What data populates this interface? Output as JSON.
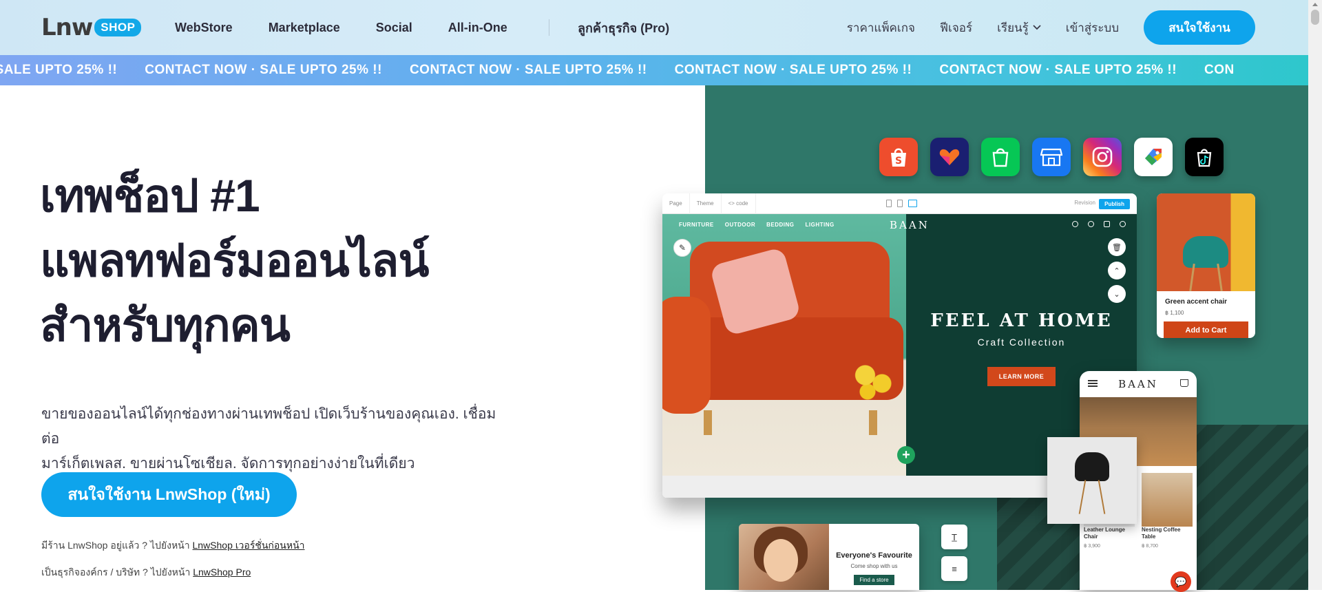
{
  "header": {
    "logo": {
      "lnw": "Lnw",
      "shop": "SHOP"
    },
    "nav_left": [
      "WebStore",
      "Marketplace",
      "Social",
      "All-in-One"
    ],
    "nav_pro": "ลูกค้าธุรกิจ (Pro)",
    "nav_right": {
      "pricing": "ราคาแพ็คเกจ",
      "features": "ฟีเจอร์",
      "learn": "เรียนรู้",
      "login": "เข้าสู่ระบบ"
    },
    "cta": "สนใจใช้งาน"
  },
  "marquee": {
    "segments": [
      "· SALE UPTO 25% !!",
      "CONTACT NOW · SALE UPTO 25% !!",
      "CONTACT NOW · SALE UPTO 25% !!",
      "CONTACT NOW · SALE UPTO 25% !!",
      "CONTACT NOW · SALE UPTO 25% !!",
      "CON"
    ]
  },
  "hero": {
    "title_line1": "เทพช็อป #1",
    "title_line2": "แพลทฟอร์มออนไลน์",
    "title_line3": "สำหรับทุกคน",
    "subtitle_line1": "ขายของออนไลน์ได้ทุกช่องทางผ่านเทพช็อป เปิดเว็บร้านของคุณเอง. เชื่อมต่อ",
    "subtitle_line2": "มาร์เก็ตเพลส. ขายผ่านโซเชียล. จัดการทุกอย่างง่ายในที่เดียว",
    "cta": "สนใจใช้งาน LnwShop (ใหม่)",
    "note1_prefix": "มีร้าน LnwShop อยู่แล้ว ? ไปยังหน้า ",
    "note1_link": "LnwShop เวอร์ชั่นก่อนหน้า",
    "note2_prefix": "เป็นธุรกิจองค์กร / บริษัท ? ไปยังหน้า ",
    "note2_link": "LnwShop Pro"
  },
  "app_icons": [
    {
      "name": "shopee-icon",
      "color": "#ee4d2d",
      "glyph": "S"
    },
    {
      "name": "lazada-icon",
      "color": "#1a1f71",
      "glyph": "♥"
    },
    {
      "name": "line-shopping-icon",
      "color": "#06c755",
      "glyph": "🛍"
    },
    {
      "name": "storefront-icon",
      "color": "#1877f2",
      "glyph": "🏪"
    },
    {
      "name": "instagram-icon",
      "color": "#d62976",
      "glyph": "◎"
    },
    {
      "name": "google-merchant-icon",
      "color": "#ffffff",
      "glyph": "G"
    },
    {
      "name": "tiktok-icon",
      "color": "#000000",
      "glyph": "♪"
    }
  ],
  "editor": {
    "toolbar": {
      "page": "Page",
      "theme": "Theme",
      "code": "<> code",
      "revision": "Revision",
      "publish": "Publish"
    },
    "nav": [
      "FURNITURE",
      "OUTDOOR",
      "BEDDING",
      "LIGHTING"
    ],
    "brand": "BAAN",
    "headline": "FEEL AT HOME",
    "subheadline": "Craft Collection",
    "button": "LEARN MORE"
  },
  "product_card": {
    "name": "Green accent chair",
    "price": "฿ 1,100",
    "button": "Add to Cart"
  },
  "phone": {
    "brand": "BAAN",
    "items": [
      {
        "label": "Leather Lounge Chair",
        "price": "฿ 3,900"
      },
      {
        "label": "Nesting Coffee Table",
        "price": "฿ 8,700"
      }
    ]
  },
  "mini_card": {
    "title": "Everyone's Favourite",
    "subtitle": "Come shop with us",
    "button": "Find a store"
  },
  "colors": {
    "accent": "#0ea4ec",
    "panel": "#2f7769",
    "dark_green": "#0f3d33",
    "orange": "#cf4517"
  }
}
